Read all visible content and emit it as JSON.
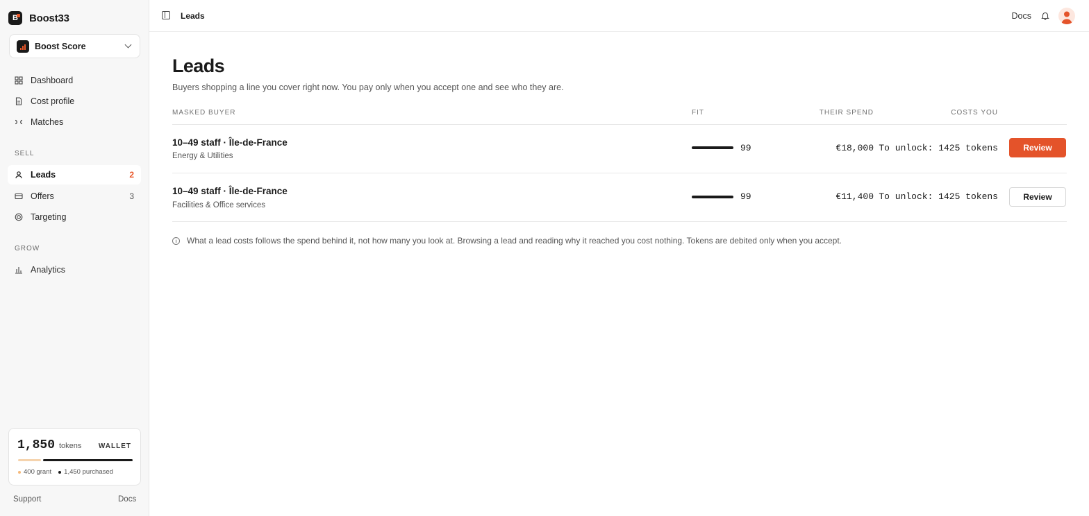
{
  "app": {
    "name": "Boost33",
    "logo_text": "B"
  },
  "workspace": {
    "name": "Boost Score"
  },
  "nav": {
    "main": [
      {
        "label": "Dashboard",
        "icon": "dashboard-icon"
      },
      {
        "label": "Cost profile",
        "icon": "file-icon"
      },
      {
        "label": "Matches",
        "icon": "matches-icon"
      }
    ],
    "sell_label": "SELL",
    "sell": [
      {
        "label": "Leads",
        "icon": "user-icon",
        "count": "2",
        "active": true
      },
      {
        "label": "Offers",
        "icon": "card-icon",
        "count": "3"
      },
      {
        "label": "Targeting",
        "icon": "target-icon"
      }
    ],
    "grow_label": "GROW",
    "grow": [
      {
        "label": "Analytics",
        "icon": "bar-chart-icon"
      }
    ]
  },
  "wallet": {
    "amount": "1,850",
    "unit": "tokens",
    "label": "WALLET",
    "grant": "400 grant",
    "purchased": "1,450 purchased",
    "grant_color": "#f5b97a",
    "purchased_color": "#1a1a1a"
  },
  "footer": {
    "support": "Support",
    "docs": "Docs"
  },
  "topbar": {
    "title": "Leads",
    "docs": "Docs"
  },
  "page": {
    "title": "Leads",
    "subtitle": "Buyers shopping a line you cover right now. You pay only when you accept one and see who they are."
  },
  "table": {
    "headers": [
      "MASKED BUYER",
      "FIT",
      "THEIR SPEND",
      "COSTS YOU"
    ],
    "rows": [
      {
        "title": "10–49 staff · Île-de-France",
        "sector": "Energy & Utilities",
        "fit": "99",
        "spend": "€18,000",
        "cost": "To unlock: 1425 tokens",
        "action": "Review"
      },
      {
        "title": "10–49 staff · Île-de-France",
        "sector": "Facilities & Office services",
        "fit": "99",
        "spend": "€11,400",
        "cost": "To unlock: 1425 tokens",
        "action": "Review"
      }
    ]
  },
  "note": "What a lead costs follows the spend behind it, not how many you look at. Browsing a lead and reading why it reached you cost nothing. Tokens are debited only when you accept.",
  "colors": {
    "accent": "#e4532a",
    "sidebar_bg": "#f7f7f7"
  }
}
